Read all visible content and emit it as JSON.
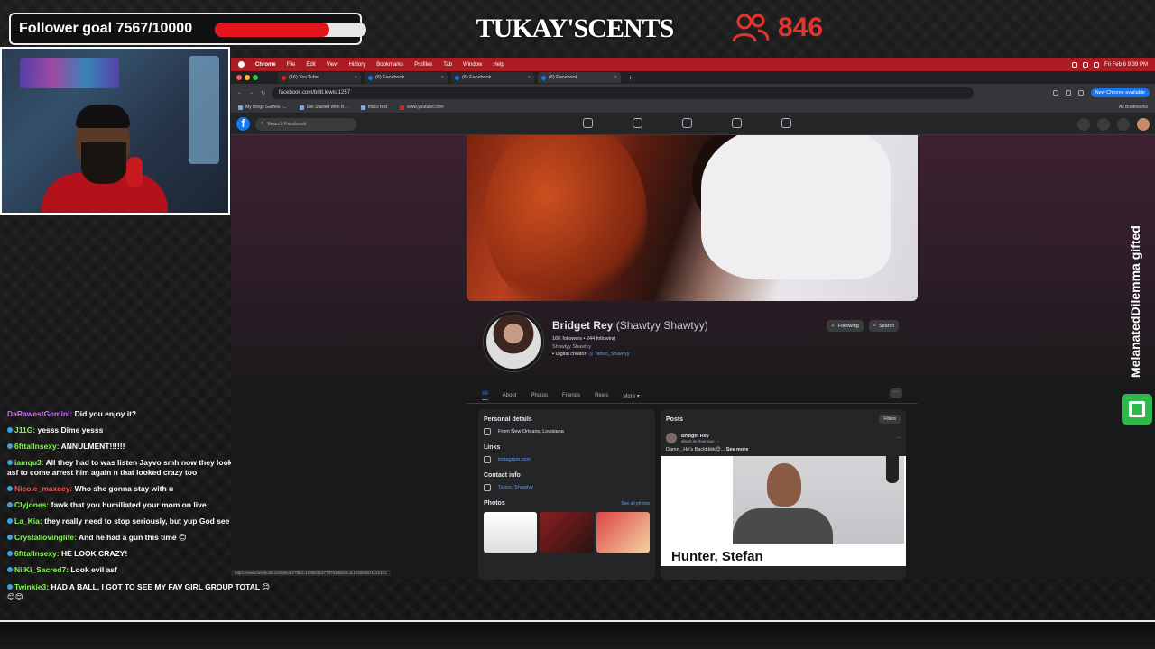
{
  "overlay": {
    "follower_goal_label": "Follower goal 7567/10000",
    "follower_goal_progress": 0.7567,
    "brand": "TUKAY'S",
    "brand_two": "2",
    "brand_cents": "CENTS",
    "viewer_count": "846",
    "gift_text": "MelanatedDilemma gifted",
    "colors": {
      "accent_red": "#e4141c",
      "gift_green": "#2eb84b"
    }
  },
  "chat": [
    {
      "user": "DaRawestGemini:",
      "text": " Did you enjoy it?",
      "color": "#c86bf5"
    },
    {
      "user": "J11G:",
      "text": " yesss Dime yesss",
      "color": "#7cfc4a"
    },
    {
      "user": "6fttallnsexy:",
      "text": " ANNULMENT!!!!!!",
      "color": "#7cfc4a"
    },
    {
      "user": "iamqu3:",
      "text": " All they had to was listen Jayvo smh now they looking crazy asf to come arrest him again n that looked crazy too",
      "color": "#7cfc4a"
    },
    {
      "user": "Nicole_maxeey:",
      "text": " Who she gonna stay with u",
      "color": "#ff4d4d"
    },
    {
      "user": "Clyjones:",
      "text": " fawk that you humiliated your mom on live",
      "color": "#7cfc4a"
    },
    {
      "user": "La_Kia:",
      "text": " they really need to stop seriously, but yup God see it all 😊",
      "color": "#7cfc4a"
    },
    {
      "user": "Crystallovinglife:",
      "text": " And he had a gun this time 😊",
      "color": "#7cfc4a"
    },
    {
      "user": "6fttallnsexy:",
      "text": " HE LOOK CRAZY!",
      "color": "#7cfc4a"
    },
    {
      "user": "NiiKi_Sacred7:",
      "text": " Look evil asf",
      "color": "#7cfc4a"
    },
    {
      "user": "Twinkie3:",
      "text": " HAD A BALL, I GOT TO SEE MY FAV GIRL GROUP TOTAL 😊😊😊",
      "color": "#7cfc4a"
    }
  ],
  "mac_menu": {
    "app": "Chrome",
    "items": [
      "File",
      "Edit",
      "View",
      "History",
      "Bookmarks",
      "Profiles",
      "Tab",
      "Window",
      "Help"
    ],
    "clock": "Fri Feb 6 9:39 PM"
  },
  "tabs": [
    {
      "label": "(16) YouTube",
      "active": false,
      "kind": "yt"
    },
    {
      "label": "(6) Facebook",
      "active": false,
      "kind": "fb"
    },
    {
      "label": "(6) Facebook",
      "active": false,
      "kind": "fb"
    },
    {
      "label": "(6) Facebook",
      "active": true,
      "kind": "fb"
    }
  ],
  "browser": {
    "url": "facebook.com/britt.lewis.1257",
    "update_label": "New Chrome available",
    "gemini_label": "Gemini",
    "bookmarks": [
      "My Bingo Games -...",
      "Get Started With R...",
      "macs test",
      "www.youtube.com"
    ],
    "all_bookmarks": "All Bookmarks",
    "status_url": "https://www.facebook.com/photo/?fbid=104563537787918&set=a.104563571121321"
  },
  "facebook": {
    "search_placeholder": "Search Facebook",
    "profile": {
      "name": "Bridget Rey",
      "alt_name": "(Shawtyy Shawtyy)",
      "stats": "16K followers • 244 following",
      "handle_line": "Shawtyy Shawtyy",
      "category": "Digital creator",
      "instagram_handle": "Tattoo_Shawtyy",
      "following_btn": "Following",
      "search_btn": "Search"
    },
    "tabs": [
      "All",
      "About",
      "Photos",
      "Friends",
      "Reels",
      "More ▾"
    ],
    "details": {
      "title": "Personal details",
      "from": "From New Orleans, Louisiana",
      "links_title": "Links",
      "link": "instagram.com",
      "contact_title": "Contact info",
      "contact": "Tattoo_Shawtyy",
      "photos_title": "Photos",
      "see_all": "See all photos"
    },
    "posts": {
      "title": "Posts",
      "filters": "Filters",
      "author": "Bridget Rey",
      "time": "about an hour ago · ◦",
      "text": "Damn , He's Backkkkk😊... ",
      "see_more": "See more",
      "mugshot_name": "Hunter, Stefan"
    }
  }
}
